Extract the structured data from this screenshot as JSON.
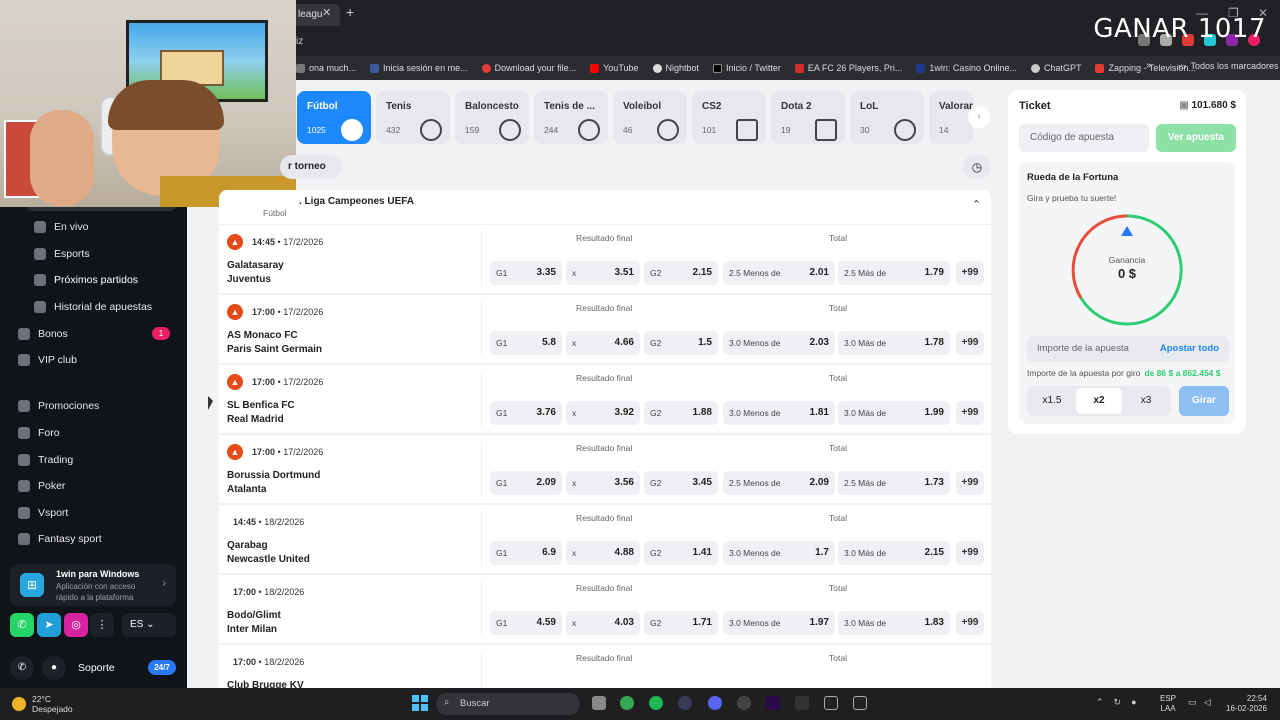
{
  "browser": {
    "tab_title": "leagu",
    "address": "iz",
    "watermark": "GANAR 1017",
    "bookmarks": [
      {
        "label": "ona much..."
      },
      {
        "label": "Inicia sesión en me..."
      },
      {
        "label": "Download your file..."
      },
      {
        "label": "YouTube"
      },
      {
        "label": "Nightbot"
      },
      {
        "label": "Inicio / Twitter"
      },
      {
        "label": "EA FC 26 Players, Pri..."
      },
      {
        "label": "1win: Casino Online..."
      },
      {
        "label": "ChatGPT"
      },
      {
        "label": "Zapping - Televisión..."
      }
    ],
    "all_bookmarks": "Todos los marcadores"
  },
  "sidebar": {
    "items": [
      {
        "label": "En vivo"
      },
      {
        "label": "Esports"
      },
      {
        "label": "Próximos partidos"
      },
      {
        "label": "Historial de apuestas"
      },
      {
        "label": "Bonos"
      },
      {
        "label": "VIP club"
      },
      {
        "label": "Promociones"
      },
      {
        "label": "Foro"
      },
      {
        "label": "Trading"
      },
      {
        "label": "Poker"
      },
      {
        "label": "Vsport"
      },
      {
        "label": "Fantasy sport"
      }
    ],
    "bonos_badge": "1",
    "app_card": {
      "title": "1win para Windows",
      "subtitle": "Aplicación con acceso rápido a la plataforma"
    },
    "language": "ES",
    "support_label": "Soporte",
    "support_badge": "24/7"
  },
  "sports_tabs": [
    {
      "name": "Fútbol",
      "count": "1025"
    },
    {
      "name": "Tenis",
      "count": "432"
    },
    {
      "name": "Baloncesto",
      "count": "159"
    },
    {
      "name": "Tenis de ...",
      "count": "244"
    },
    {
      "name": "Voleibol",
      "count": "46"
    },
    {
      "name": "CS2",
      "count": "101"
    },
    {
      "name": "Dota 2",
      "count": "19"
    },
    {
      "name": "LoL",
      "count": "30"
    },
    {
      "name": "Valoran",
      "count": "14"
    }
  ],
  "filter_label": "r torneo",
  "league": {
    "name": ". Liga Campeones UEFA",
    "sport": "Fútbol"
  },
  "market_labels": {
    "result": "Resultado final",
    "total": "Total",
    "g1": "G1",
    "x": "x",
    "g2": "G2",
    "more": "+99"
  },
  "matches": [
    {
      "time": "14:45",
      "date": "17/2/2026",
      "home": "Galatasaray",
      "away": "Juventus",
      "g1": "3.35",
      "x": "3.51",
      "g2": "2.15",
      "under_label": "2.5 Menos de",
      "under": "2.01",
      "over_label": "2.5 Más de",
      "over": "1.79"
    },
    {
      "time": "17:00",
      "date": "17/2/2026",
      "home": "AS Monaco FC",
      "away": "Paris Saint Germain",
      "g1": "5.8",
      "x": "4.66",
      "g2": "1.5",
      "under_label": "3.0 Menos de",
      "under": "2.03",
      "over_label": "3.0 Más de",
      "over": "1.78"
    },
    {
      "time": "17:00",
      "date": "17/2/2026",
      "home": "SL Benfica FC",
      "away": "Real Madrid",
      "g1": "3.76",
      "x": "3.92",
      "g2": "1.88",
      "under_label": "3.0 Menos de",
      "under": "1.81",
      "over_label": "3.0 Más de",
      "over": "1.99"
    },
    {
      "time": "17:00",
      "date": "17/2/2026",
      "home": "Borussia Dortmund",
      "away": "Atalanta",
      "g1": "2.09",
      "x": "3.56",
      "g2": "3.45",
      "under_label": "2.5 Menos de",
      "under": "2.09",
      "over_label": "2.5 Más de",
      "over": "1.73"
    },
    {
      "time": "14:45",
      "date": "18/2/2026",
      "home": "Qarabag",
      "away": "Newcastle United",
      "g1": "6.9",
      "x": "4.88",
      "g2": "1.41",
      "under_label": "3.0 Menos de",
      "under": "1.7",
      "over_label": "3.0 Más de",
      "over": "2.15"
    },
    {
      "time": "17:00",
      "date": "18/2/2026",
      "home": "Bodo/Glimt",
      "away": "Inter Milan",
      "g1": "4.59",
      "x": "4.03",
      "g2": "1.71",
      "under_label": "3.0 Menos de",
      "under": "1.97",
      "over_label": "3.0 Más de",
      "over": "1.83"
    },
    {
      "time": "17:00",
      "date": "18/2/2026",
      "home": "Club Brugge KV",
      "away": ""
    }
  ],
  "ticket": {
    "title": "Ticket",
    "balance": "101.680 $",
    "code_placeholder": "Código de apuesta",
    "view_button": "Ver apuesta",
    "fortune_title": "Rueda de la Fortuna",
    "fortune_subtitle": "Gira y prueba tu suerte!",
    "gain_label": "Ganancia",
    "gain_value": "0 $",
    "amount_placeholder": "Importe de la apuesta",
    "bet_all": "Apostar todo",
    "range_label": "Importe de la apuesta por giro",
    "range_value": "de 86 $ a 862.454 $",
    "multipliers": [
      "x1.5",
      "x2",
      "x3"
    ],
    "selected_multiplier": "x2",
    "spin_button": "Girar"
  },
  "taskbar": {
    "temp": "22°C",
    "weather": "Despejado",
    "search": "Buscar",
    "lang1": "ESP",
    "lang2": "LAA",
    "time": "22:54",
    "date": "16-02-2026"
  }
}
